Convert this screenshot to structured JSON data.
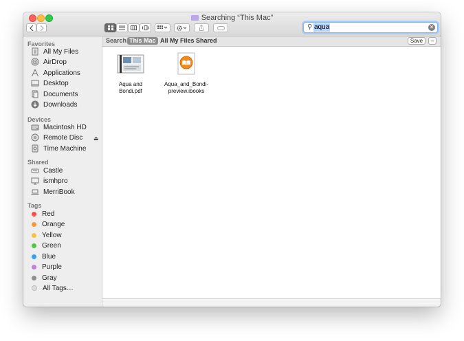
{
  "window": {
    "title": "Searching “This Mac”"
  },
  "toolbar": {
    "back_icon": "chevron-left-icon",
    "forward_icon": "chevron-right-icon",
    "view_icons": [
      "icon-view-icon",
      "list-view-icon",
      "column-view-icon",
      "coverflow-view-icon"
    ],
    "arrange_icon": "arrange-icon",
    "action_icon": "gear-icon",
    "share_icon": "share-icon",
    "tag_icon": "tag-icon",
    "search_value": "aqua"
  },
  "sidebar": {
    "favorites_header": "Favorites",
    "favorites": [
      {
        "label": "All My Files"
      },
      {
        "label": "AirDrop"
      },
      {
        "label": "Applications"
      },
      {
        "label": "Desktop"
      },
      {
        "label": "Documents"
      },
      {
        "label": "Downloads"
      }
    ],
    "devices_header": "Devices",
    "devices": [
      {
        "label": "Macintosh HD"
      },
      {
        "label": "Remote Disc"
      },
      {
        "label": "Time Machine"
      }
    ],
    "shared_header": "Shared",
    "shared": [
      {
        "label": "Castle"
      },
      {
        "label": "ismhpro"
      },
      {
        "label": "MerriBook"
      }
    ],
    "tags_header": "Tags",
    "tags": [
      {
        "label": "Red",
        "color": "#f2524d"
      },
      {
        "label": "Orange",
        "color": "#f59a36"
      },
      {
        "label": "Yellow",
        "color": "#f5c542"
      },
      {
        "label": "Green",
        "color": "#56c24a"
      },
      {
        "label": "Blue",
        "color": "#3c9cf0"
      },
      {
        "label": "Purple",
        "color": "#c77ddb"
      },
      {
        "label": "Gray",
        "color": "#8e8e8e"
      },
      {
        "label": "All Tags…",
        "color": "#dedede"
      }
    ]
  },
  "scopebar": {
    "label": "Search:",
    "scopes": [
      "This Mac",
      "All My Files",
      "Shared"
    ],
    "save": "Save",
    "minus": "–"
  },
  "files": [
    {
      "name_line1": "Aqua and",
      "name_line2": "Bondi.pdf",
      "icon": "pdf-document-icon"
    },
    {
      "name_line1": "Aqua_and_Bondi-",
      "name_line2": "preview.ibooks",
      "icon": "ibooks-icon"
    }
  ]
}
